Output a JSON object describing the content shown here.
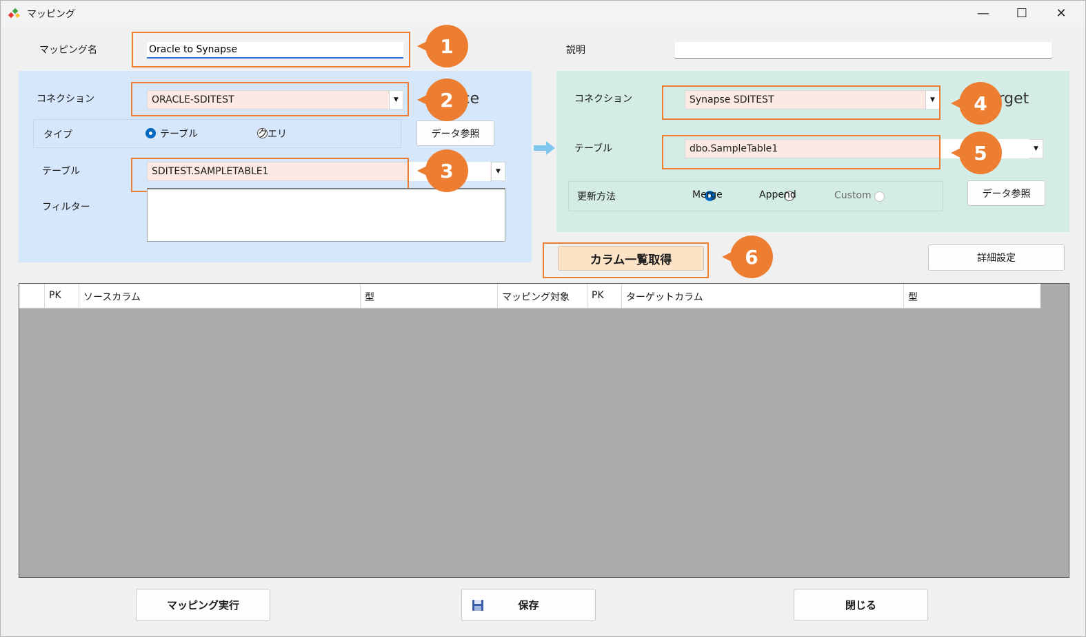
{
  "window": {
    "title": "マッピング",
    "minimize": "—",
    "maximize": "☐",
    "close": "✕"
  },
  "mapping_name": {
    "label": "マッピング名",
    "value": "Oracle to Synapse"
  },
  "description": {
    "label": "説明",
    "value": ""
  },
  "source": {
    "heading_partial": "rce",
    "connection_label": "コネクション",
    "connection_value": "ORACLE-SDITEST",
    "type_label": "タイプ",
    "type_table": "テーブル",
    "type_query": "クエリ",
    "browse_button": "データ参照",
    "table_label": "テーブル",
    "table_value": "SDITEST.SAMPLETABLE1",
    "filter_label": "フィルター",
    "filter_value": ""
  },
  "target": {
    "heading_partial": "arget",
    "connection_label": "コネクション",
    "connection_value": "Synapse SDITEST",
    "table_label": "テーブル",
    "table_value": "dbo.SampleTable1",
    "update_label": "更新方法",
    "update_merge": "Merge",
    "update_append": "Append",
    "update_custom": "Custom",
    "browse_button": "データ参照"
  },
  "get_columns_button": "カラム一覧取得",
  "advanced_button": "詳細設定",
  "grid": {
    "columns": [
      "",
      "PK",
      "ソースカラム",
      "型",
      "マッピング対象",
      "PK",
      "ターゲットカラム",
      "型"
    ]
  },
  "footer": {
    "run_button": "マッピング実行",
    "save_button": "保存",
    "close_button": "閉じる"
  },
  "callouts": [
    "1",
    "2",
    "3",
    "4",
    "5",
    "6"
  ],
  "colors": {
    "accent_orange": "#ed7d31",
    "source_panel": "#d6e6fb",
    "target_panel": "#d3ece5",
    "combo_bg": "#fde9e4",
    "grid_bg": "#ababab"
  }
}
